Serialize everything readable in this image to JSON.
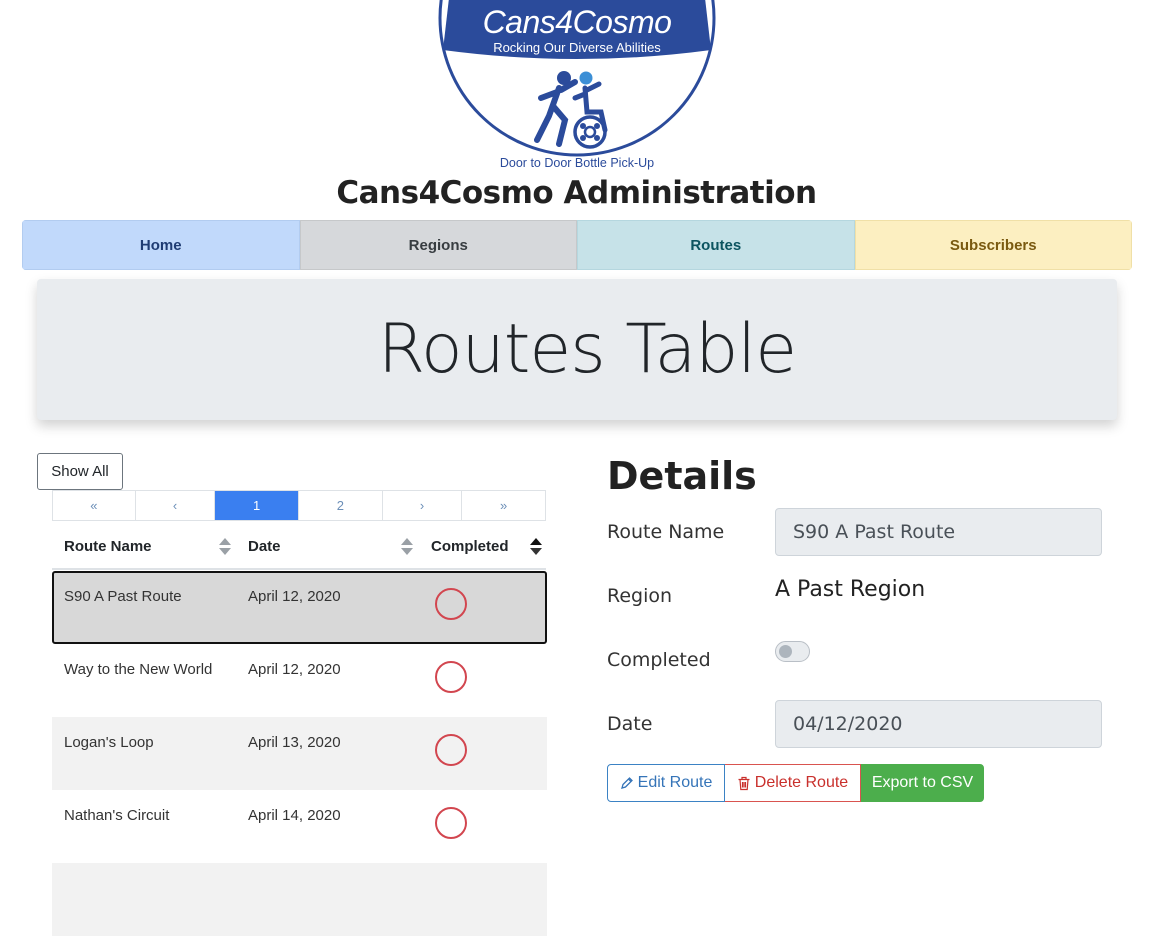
{
  "logo": {
    "title": "Cans4Cosmo",
    "subtitle": "Rocking Our Diverse Abilities",
    "tagline": "Door to Door Bottle Pick-Up"
  },
  "header": {
    "title": "Cans4Cosmo Administration"
  },
  "nav": {
    "home": "Home",
    "regions": "Regions",
    "routes": "Routes",
    "subscribers": "Subscribers"
  },
  "jumbotron": {
    "title": "Routes Table"
  },
  "table": {
    "show_all": "Show All",
    "pagination": [
      "«",
      "‹",
      "1",
      "2",
      "›",
      "»"
    ],
    "current_page": "1",
    "columns": [
      "Route Name",
      "Date",
      "Completed"
    ],
    "sorted_column": "Completed",
    "rows": [
      {
        "name": "S90 A Past Route",
        "date": "April 12, 2020",
        "completed": false,
        "selected": true
      },
      {
        "name": "Way to the New World",
        "date": "April 12, 2020",
        "completed": false
      },
      {
        "name": "Logan's Loop",
        "date": "April 13, 2020",
        "completed": false
      },
      {
        "name": "Nathan's Circuit",
        "date": "April 14, 2020",
        "completed": false
      }
    ]
  },
  "details": {
    "title": "Details",
    "route_name_label": "Route Name",
    "route_name_value": "S90 A Past Route",
    "region_label": "Region",
    "region_value": "A Past Region",
    "completed_label": "Completed",
    "completed_value": false,
    "date_label": "Date",
    "date_value": "04/12/2020",
    "buttons": {
      "edit": "Edit Route",
      "delete": "Delete Route",
      "export": "Export to CSV"
    }
  },
  "colors": {
    "logo_blue": "#2b4b9b",
    "page_active": "#3a7ff0",
    "ring_red": "#d2464f",
    "export_green": "#4cae4c"
  }
}
